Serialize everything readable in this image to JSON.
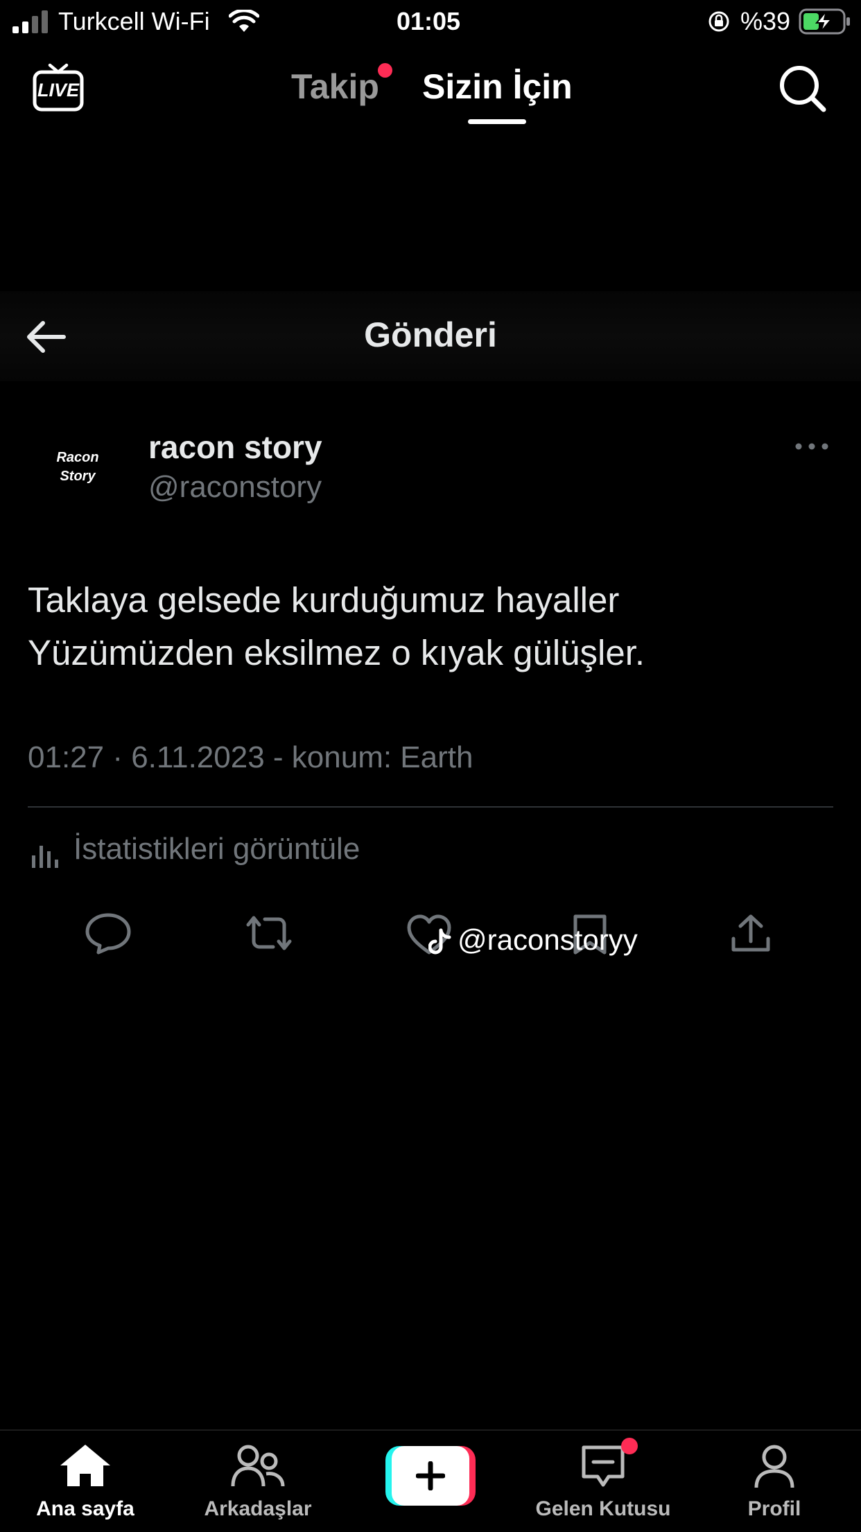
{
  "status_bar": {
    "carrier": "Turkcell Wi-Fi",
    "time": "01:05",
    "battery": "%39"
  },
  "top_nav": {
    "live_label": "LIVE",
    "tabs": [
      {
        "label": "Takip",
        "active": false
      },
      {
        "label": "Sizin İçin",
        "active": true
      }
    ]
  },
  "post": {
    "header_title": "Gönderi",
    "avatar_text_line1": "Racon",
    "avatar_text_line2": "Story",
    "author_name": "racon story",
    "author_handle": "@raconstory",
    "text_line1": "Taklaya gelsede kurduğumuz hayaller",
    "text_line2": "Yüzümüzden eksilmez o kıyak gülüşler.",
    "meta": "01:27 · 6.11.2023 - konum: Earth",
    "stats_label": "İstatistikleri görüntüle",
    "watermark": "@raconstoryy"
  },
  "bottom_nav": {
    "items": [
      {
        "label": "Ana sayfa",
        "active": true
      },
      {
        "label": "Arkadaşlar",
        "active": false
      },
      {
        "label": "Gelen Kutusu",
        "active": false
      },
      {
        "label": "Profil",
        "active": false
      }
    ]
  },
  "colors": {
    "background": "#000000",
    "notification_dot": "#fe2c55",
    "battery_green": "#4cd964",
    "secondary_text": "#71767b"
  }
}
